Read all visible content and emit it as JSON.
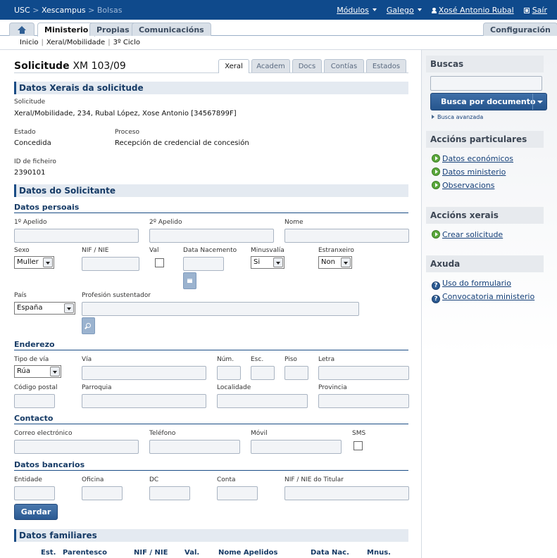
{
  "topbar": {
    "crumb_root": "USC",
    "crumb_sep": ">",
    "crumb_app": "Xescampus",
    "crumb_current": "Bolsas",
    "modules": "Módulos",
    "language": "Galego",
    "user": "Xosé Antonio Rubal",
    "logout": "Saír"
  },
  "tabs": {
    "home": "home-icon",
    "items": [
      "Ministerio",
      "Propias",
      "Comunicacións"
    ],
    "config": "Configuración"
  },
  "subnav": {
    "items": [
      "Inicio",
      "Xeral/Mobilidade",
      "3º Ciclo"
    ]
  },
  "page": {
    "title": "Solicitude",
    "number": "XM 103/09",
    "form_tabs": [
      "Xeral",
      "Academ",
      "Docs",
      "Contías",
      "Estados"
    ]
  },
  "general": {
    "heading": "Datos Xerais da solicitude",
    "solicitude_label": "Solicitude",
    "solicitude_value": "Xeral/Mobilidade, 234, Rubal López, Xose Antonio [34567899F]",
    "estado_label": "Estado",
    "estado_value": "Concedida",
    "proceso_label": "Proceso",
    "proceso_value": "Recepción de credencial de concesión",
    "id_label": "ID de ficheiro",
    "id_value": "2390101"
  },
  "applicant": {
    "heading": "Datos do Solicitante",
    "personal": {
      "heading": "Datos persoais",
      "apelido1": "1º Apelido",
      "apelido2": "2º Apelido",
      "nome": "Nome",
      "sexo": "Sexo",
      "sexo_value": "Muller",
      "nif": "NIF / NIE",
      "val": "Val",
      "data_nac": "Data Nacemento",
      "minusvalia": "Minusvalía",
      "minusvalia_value": "Si",
      "estranxeiro": "Estranxeiro",
      "estranxeiro_value": "Non",
      "pais": "País",
      "pais_value": "España",
      "profesion": "Profesión sustentador"
    },
    "address": {
      "heading": "Enderezo",
      "tipo_via": "Tipo de vía",
      "tipo_via_value": "Rúa",
      "via": "Vía",
      "num": "Núm.",
      "esc": "Esc.",
      "piso": "Piso",
      "letra": "Letra",
      "cp": "Código postal",
      "parroquia": "Parroquia",
      "localidade": "Localidade",
      "provincia": "Provincia"
    },
    "contact": {
      "heading": "Contacto",
      "email": "Correo electrónico",
      "telefono": "Teléfono",
      "movil": "Móvil",
      "sms": "SMS"
    },
    "bank": {
      "heading": "Datos bancarios",
      "entidade": "Entidade",
      "oficina": "Oficina",
      "dc": "DC",
      "conta": "Conta",
      "nif_titular": "NIF / NIE do Titular"
    },
    "save": "Gardar"
  },
  "family": {
    "heading": "Datos familiares",
    "columns": [
      "Est.",
      "Parentesco",
      "NIF / NIE",
      "Val.",
      "Nome Apelidos",
      "Data Nac.",
      "Mnus."
    ]
  },
  "sidebar": {
    "search_heading": "Buscas",
    "search_placeholder": "",
    "search_button": "Busca por documento",
    "advanced": "Busca avanzada",
    "particular_heading": "Accións particulares",
    "particular_links": [
      "Datos económicos",
      "Datos ministerio",
      "Observacions"
    ],
    "general_heading": "Accións xerais",
    "general_links": [
      "Crear solicitude"
    ],
    "help_heading": "Axuda",
    "help_links": [
      "Uso do formulario",
      "Convocatoria ministerio"
    ]
  }
}
